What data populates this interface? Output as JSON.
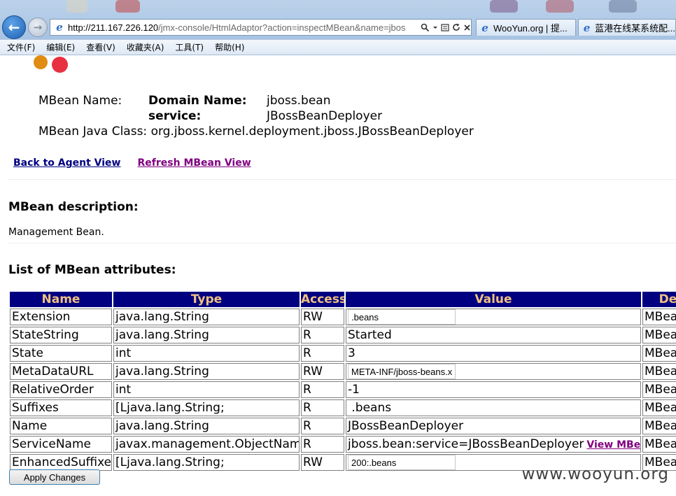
{
  "browser": {
    "url_host": "http://211.167.226.120",
    "url_path": "/jmx-console/HtmlAdaptor?action=inspectMBean&name=jbos",
    "tabs": [
      {
        "label": "WooYun.org | 提..."
      },
      {
        "label": "蓝港在线某系统配..."
      }
    ],
    "menu": [
      "文件(F)",
      "编辑(E)",
      "查看(V)",
      "收藏夹(A)",
      "工具(T)",
      "帮助(H)"
    ],
    "back_glyph": "←",
    "forward_glyph": "→"
  },
  "mbean": {
    "name_label": "MBean Name:",
    "domain_key": "Domain Name:",
    "domain_value": "jboss.bean",
    "service_key": "service:",
    "service_value": "JBossBeanDeployer",
    "class_label": "MBean Java Class:",
    "class_value": "org.jboss.kernel.deployment.jboss.JBossBeanDeployer"
  },
  "links": {
    "back": "Back to Agent View",
    "refresh": "Refresh MBean View"
  },
  "description": {
    "heading": "MBean description:",
    "text": "Management Bean."
  },
  "attributes": {
    "heading": "List of MBean attributes:",
    "columns": [
      "Name",
      "Type",
      "Access",
      "Value",
      "De"
    ],
    "rows": [
      {
        "name": "Extension",
        "type": "java.lang.String",
        "access": "RW",
        "value": ".beans",
        "desc": "MBean"
      },
      {
        "name": "StateString",
        "type": "java.lang.String",
        "access": "R",
        "value": "Started",
        "desc": "MBean"
      },
      {
        "name": "State",
        "type": "int",
        "access": "R",
        "value": "3",
        "desc": "MBean"
      },
      {
        "name": "MetaDataURL",
        "type": "java.lang.String",
        "access": "RW",
        "value": "META-INF/jboss-beans.xml",
        "desc": "MBean"
      },
      {
        "name": "RelativeOrder",
        "type": "int",
        "access": "R",
        "value": "-1",
        "desc": "MBean"
      },
      {
        "name": "Suffixes",
        "type": "[Ljava.lang.String;",
        "access": "R",
        "value": " .beans",
        "desc": "MBean"
      },
      {
        "name": "Name",
        "type": "java.lang.String",
        "access": "R",
        "value": "JBossBeanDeployer",
        "desc": "MBean"
      },
      {
        "name": "ServiceName",
        "type": "javax.management.ObjectName",
        "access": "R",
        "value": "jboss.bean:service=JBossBeanDeployer",
        "link": "View MBean",
        "desc": "MBean"
      },
      {
        "name": "EnhancedSuffixes",
        "type": "[Ljava.lang.String;",
        "access": "RW",
        "value": "200:.beans",
        "desc": "MBean"
      }
    ]
  },
  "apply_label": "Apply Changes",
  "watermark": "www.wooyun.org",
  "colors": {
    "header_bg": "#000080",
    "header_text": "#f0c080",
    "link_back": "#000080",
    "link_visited": "#800080"
  }
}
